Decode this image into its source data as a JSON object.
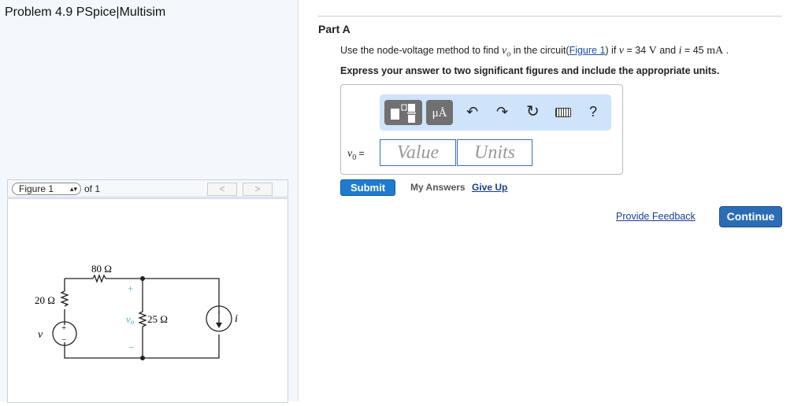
{
  "page_title": "Problem 4.9 PSpice|Multisim",
  "figure_nav": {
    "selected": "Figure 1",
    "of_label": "of 1",
    "prev": "<",
    "next": ">"
  },
  "circuit": {
    "r1": "80 Ω",
    "r2": "20 Ω",
    "r3": "25 Ω",
    "v_label": "v",
    "vo_label": "v",
    "vo_sub": "o",
    "i_label": "i",
    "plus": "+",
    "minus": "−"
  },
  "part": {
    "title": "Part A",
    "q_pre": "Use the node-voltage method to find ",
    "q_var": "v",
    "q_sub": "o",
    "q_mid": " in the circuit(",
    "q_link": "Figure 1",
    "q_mid2": ") if ",
    "q_v": "v",
    "q_eq1": " = 34 ",
    "q_u1": "V",
    "q_and": " and ",
    "q_i": "i",
    "q_eq2": " = 45 ",
    "q_u2": "mA",
    "q_end": " .",
    "instruction": "Express your answer to two significant figures and include the appropriate units."
  },
  "toolbar": {
    "units_btn": "μÅ",
    "help": "?"
  },
  "answer": {
    "label_var": "v",
    "label_sub": "0",
    "label_eq": " =",
    "value_placeholder": "Value",
    "units_placeholder": "Units"
  },
  "actions": {
    "submit": "Submit",
    "my_answers": "My Answers",
    "give_up": "Give Up",
    "feedback": "Provide Feedback",
    "continue": "Continue"
  }
}
